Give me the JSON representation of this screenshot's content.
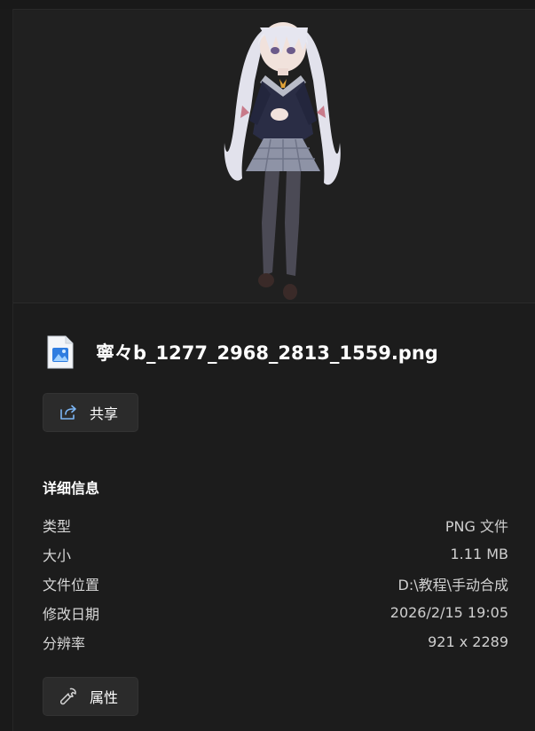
{
  "file": {
    "name": "寧々b_1277_2968_2813_1559.png",
    "icon": "png-image-file-icon"
  },
  "actions": {
    "share_label": "共享",
    "share_icon": "share-icon",
    "properties_label": "属性",
    "properties_icon": "wrench-icon"
  },
  "details": {
    "title": "详细信息",
    "rows": [
      {
        "key": "类型",
        "value": "PNG 文件"
      },
      {
        "key": "大小",
        "value": "1.11 MB"
      },
      {
        "key": "文件位置",
        "value": "D:\\教程\\手动合成"
      },
      {
        "key": "修改日期",
        "value": "2026/2/15 19:05"
      },
      {
        "key": "分辨率",
        "value": "921 x 2289"
      }
    ]
  },
  "colors": {
    "background": "#1c1c1c",
    "preview_background": "#202020",
    "button_background": "#2b2b2b",
    "accent_icon_blue": "#3d8ef0"
  }
}
